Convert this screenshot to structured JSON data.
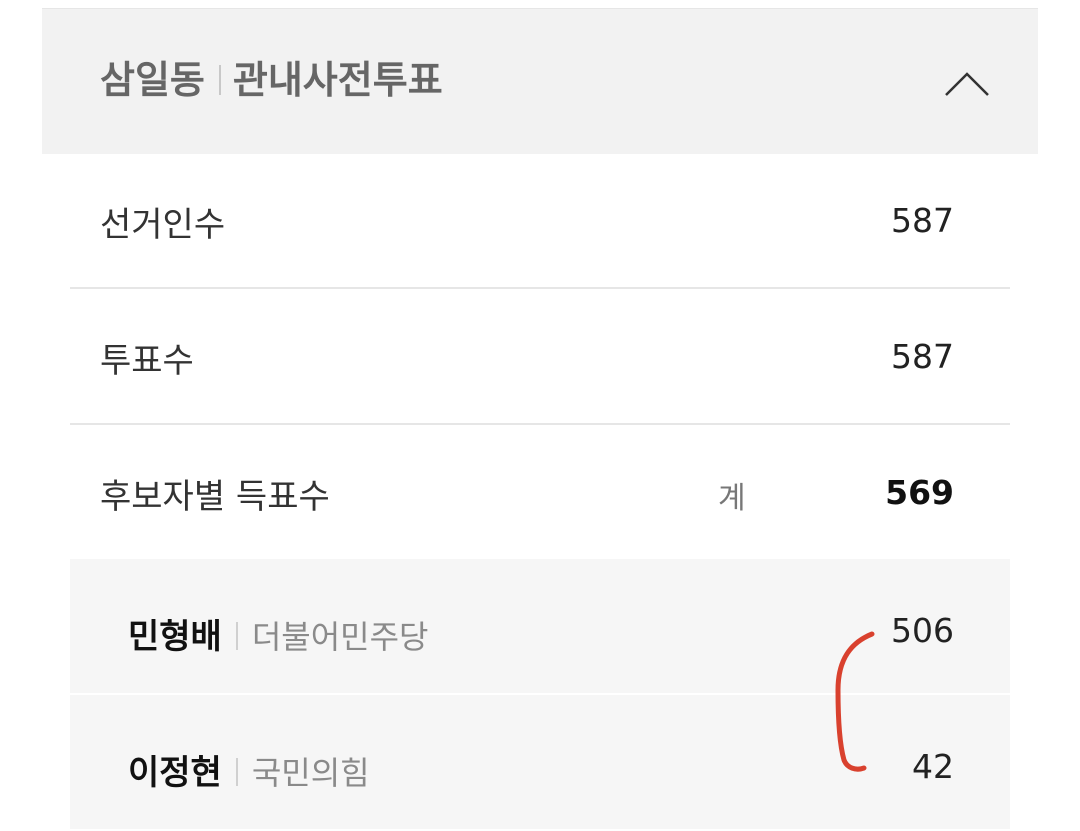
{
  "header": {
    "dong": "삼일동",
    "poll_type": "관내사전투표",
    "toggle_icon": "chevron-up-icon"
  },
  "stats": {
    "electors_label": "선거인수",
    "electors_value": "587",
    "votes_label": "투표수",
    "votes_value": "587",
    "candidate_votes_label": "후보자별 득표수",
    "total_label": "계",
    "total_value": "569"
  },
  "candidates": [
    {
      "name": "민형배",
      "party": "더불어민주당",
      "votes": "506"
    },
    {
      "name": "이정현",
      "party": "국민의힘",
      "votes": "42"
    }
  ],
  "colors": {
    "header_bg": "#f2f2f2",
    "candidate_bg": "#f6f6f6",
    "annotation": "#d9412e"
  }
}
